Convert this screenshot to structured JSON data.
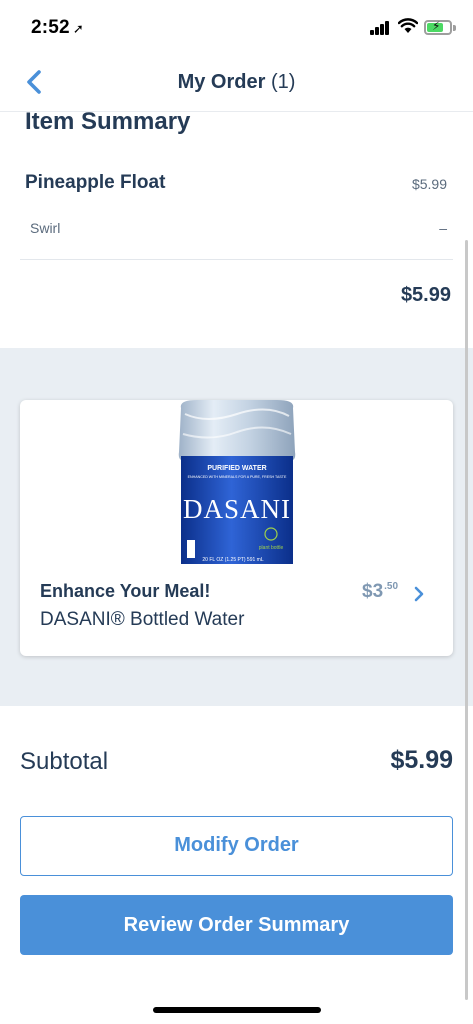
{
  "status_bar": {
    "time": "2:52",
    "location_icon": "location-arrow-icon"
  },
  "nav": {
    "title": "My Order",
    "count": "(1)",
    "back_icon": "chevron-left-icon"
  },
  "summary": {
    "title": "Item Summary",
    "item": {
      "name": "Pineapple Float",
      "price": "$5.99"
    },
    "modifier": {
      "name": "Swirl",
      "price": "–"
    },
    "total": "$5.99"
  },
  "upsell": {
    "heading": "Enhance Your Meal!",
    "item": "DASANI® Bottled Water",
    "price_main": "$3",
    "price_cents": ".50",
    "product_image": {
      "label_brand": "DASANI",
      "label_top": "PURIFIED WATER",
      "label_sub": "ENHANCED WITH MINERALS FOR A PURE, FRESH TASTE",
      "label_bottom": "20 FL OZ (1.25 PT) 591 mL",
      "label_eco": "plant bottle"
    }
  },
  "subtotal": {
    "label": "Subtotal",
    "value": "$5.99"
  },
  "buttons": {
    "modify": "Modify Order",
    "review": "Review Order Summary"
  },
  "colors": {
    "accent": "#4a90d9",
    "text": "#253b56",
    "band": "#e9eef3"
  }
}
